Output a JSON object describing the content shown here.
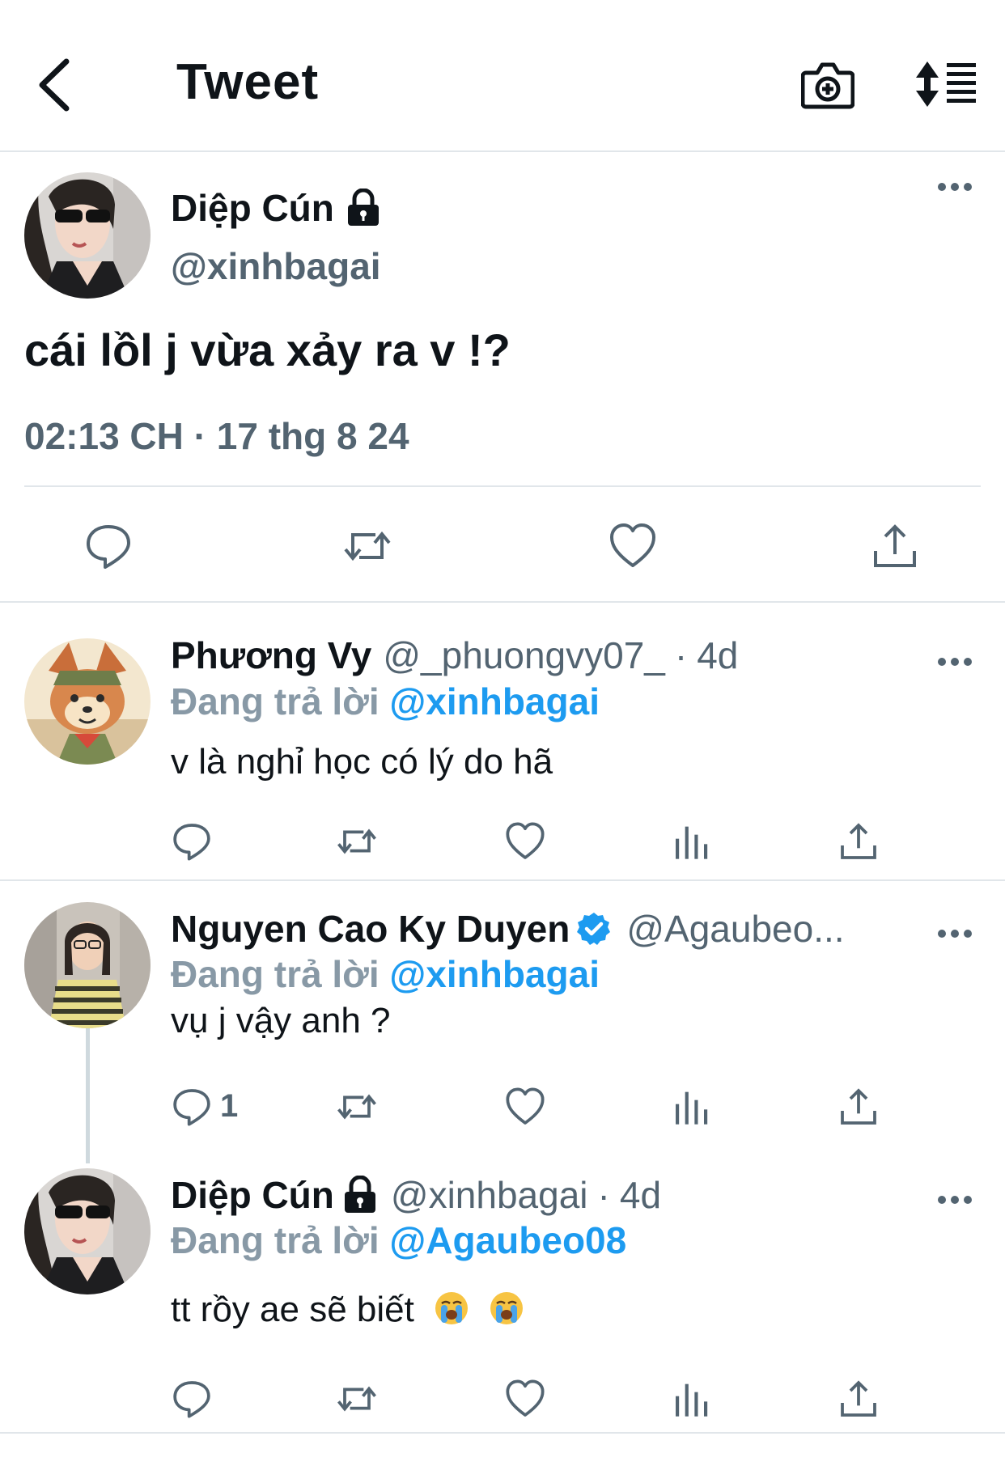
{
  "header": {
    "title": "Tweet",
    "icons": [
      "back-arrow-icon",
      "camera-add-icon",
      "sort-icon"
    ]
  },
  "main_tweet": {
    "name": "Diệp Cún",
    "handle": "@xinhbagai",
    "text": "cái lồl j vừa xảy ra v !?",
    "time": "02:13 CH · 17 thg 8 24"
  },
  "replies": [
    {
      "name": "Phương Vy",
      "handle": "@_phuongvy07_",
      "dot": "·",
      "age": "4d",
      "replying_label": "Đang trả lời",
      "replying_to": "@xinhbagai",
      "text": "v là nghỉ học có lý do hã"
    },
    {
      "name": "Nguyen Cao Ky Duyen",
      "handle": "@Agaubeo...",
      "replying_label": "Đang trả lời",
      "replying_to": "@xinhbagai",
      "text": "vụ j vậy anh ?",
      "reply_count": "1",
      "verified": true
    },
    {
      "name": "Diệp Cún",
      "handle": "@xinhbagai",
      "dot": "·",
      "age": "4d",
      "replying_label": "Đang trả lời",
      "replying_to": "@Agaubeo08",
      "text": "tt rồy ae sẽ biết",
      "emojis": [
        "crying-face-emoji",
        "crying-face-emoji"
      ]
    }
  ],
  "colors": {
    "text": "#0f1419",
    "secondary": "#536471",
    "replying_label": "#8899a6",
    "link": "#1d9bf0",
    "divider": "#e1e6ea"
  }
}
